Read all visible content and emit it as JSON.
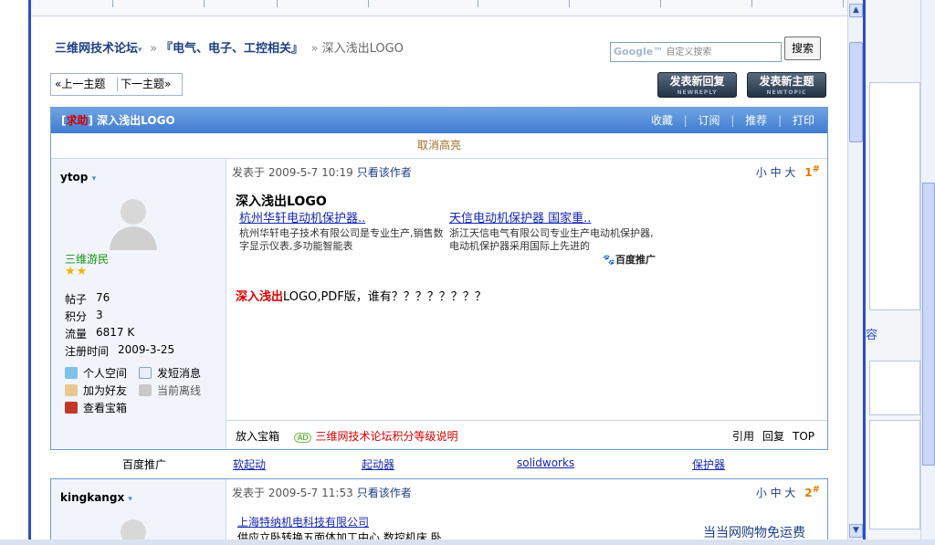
{
  "breadcrumb": {
    "forum": "三维网技术论坛",
    "forum_caret": "▾",
    "sep": "»",
    "section": "『电气、电子、工控相关』",
    "current": "深入浅出LOGO"
  },
  "search": {
    "google_mark": "Google™",
    "placeholder": "自定义搜索",
    "button": "搜索"
  },
  "pager": {
    "prev": "«上一主题",
    "next": "下一主题»"
  },
  "buttons": {
    "reply": "发表新回复",
    "reply_sub": "NEWREPLY",
    "topic": "发表新主题",
    "topic_sub": "NEWTOPIC"
  },
  "thread": {
    "tag_open": "[",
    "tag": "求助",
    "tag_close": "]",
    "title": "深入浅出LOGO",
    "actions": [
      "收藏",
      "订阅",
      "推荐",
      "打印"
    ],
    "sep": "|",
    "cancel_highlight": "取消高亮"
  },
  "post1": {
    "author": "ytop",
    "caret": "▾",
    "rank": "三维游民",
    "stars": "★★",
    "stats": [
      {
        "label": "帖子",
        "value": "76"
      },
      {
        "label": "积分",
        "value": "3"
      },
      {
        "label": "流量",
        "value": "6817 K"
      },
      {
        "label": "注册时间",
        "value": "2009-3-25"
      }
    ],
    "links": {
      "space": "个人空间",
      "pm": "发短消息",
      "friend": "加为好友",
      "offline": "当前离线",
      "treasure": "查看宝箱"
    },
    "posted_label": "发表于",
    "posted_at": "2009-5-7 10:19",
    "author_only": "只看该作者",
    "font_small": "小",
    "font_mid": "中",
    "font_big": "大",
    "floor": "1",
    "floor_mark": "#",
    "title": "深入浅出LOGO",
    "ads": [
      {
        "title": "杭州华轩电动机保护器..",
        "desc": "杭州华轩电子技术有限公司是专业生产,销售数字显示仪表,多功能智能表"
      },
      {
        "title": "天信电动机保护器 国家重..",
        "desc": "浙江天信电气有限公司专业生产电动机保护器,电动机保护器采用国际上先进的"
      }
    ],
    "ad_brand_paw": "🐾",
    "ad_brand": "百度推广",
    "body_hl": "深入浅出",
    "body_rest": "LOGO,PDF版，谁有？？？？？？？？",
    "foot_left": "放入宝箱",
    "foot_ad_badge": "AD",
    "foot_ad_text": "三维网技术论坛积分等级说明",
    "foot_actions": [
      "引用",
      "回复",
      "TOP"
    ]
  },
  "links_bar": {
    "label": "百度推广",
    "items": [
      "软起动",
      "起动器",
      "solidworks",
      "保护器"
    ]
  },
  "post2": {
    "author": "kingkangx",
    "caret": "▾",
    "posted_label": "发表于",
    "posted_at": "2009-5-7 11:53",
    "author_only": "只看该作者",
    "font_small": "小",
    "font_mid": "中",
    "font_big": "大",
    "floor": "2",
    "floor_mark": "#",
    "ad_title": "上海特纳机电科技有限公司",
    "ad_desc": "供应立卧转换五面体加工中心,数控机床 卧",
    "ad_right": "当当网购物免运费"
  },
  "right_frame": {
    "text": "容"
  }
}
